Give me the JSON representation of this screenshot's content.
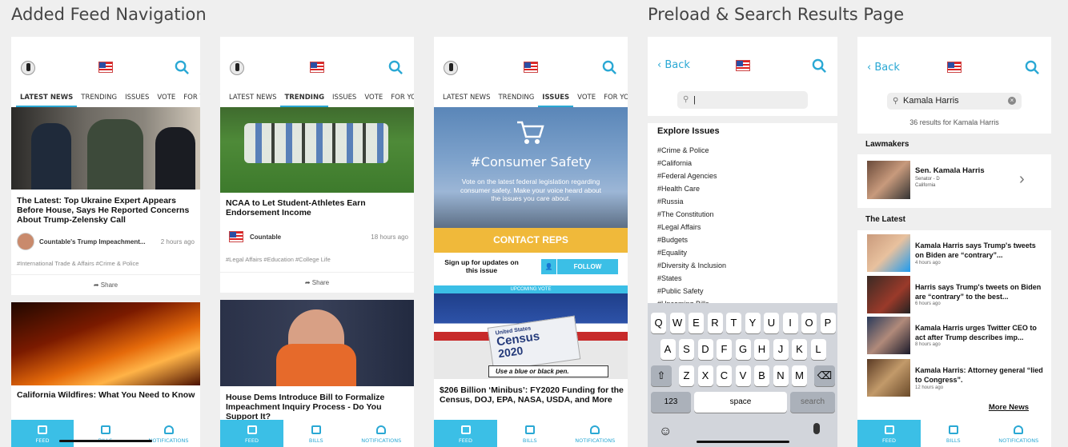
{
  "titles": {
    "left": "Added Feed Navigation",
    "right": "Preload & Search Results Page"
  },
  "colors": {
    "accent": "#2aa8d4",
    "contact": "#f0b93a"
  },
  "tabs": [
    "LATEST NEWS",
    "TRENDING",
    "ISSUES",
    "VOTE",
    "FOR YOU"
  ],
  "bottom_nav": {
    "feed": "FEED",
    "bills": "BILLS",
    "notifications": "NOTIFICATIONS"
  },
  "phone1": {
    "card1": {
      "title": "The Latest: Top Ukraine Expert Appears Before House, Says He Reported Concerns About Trump-Zelensky Call",
      "source": "Countable's Trump Impeachment...",
      "time": "2 hours ago",
      "tags": "#International Trade & Affairs  #Crime & Police",
      "share": "Share"
    },
    "card2": {
      "title": "California Wildfires: What You Need to Know"
    }
  },
  "phone2": {
    "card1": {
      "title": "NCAA to Let Student-Athletes Earn Endorsement Income",
      "source": "Countable",
      "time": "18 hours ago",
      "tags": "#Legal Affairs  #Education  #College Life",
      "share": "Share"
    },
    "card2": {
      "title": "House Dems Introduce Bill to Formalize Impeachment Inquiry Process - Do You Support It?"
    }
  },
  "phone3": {
    "issue_title": "#Consumer Safety",
    "issue_desc": "Vote on the latest federal legislation regarding consumer safety. Make your voice heard about the issues you care about.",
    "contact": "CONTACT REPS",
    "signup": "Sign up for updates on this issue",
    "follow": "FOLLOW",
    "upcoming": "UPCOMING VOTE",
    "census_line1": "United States",
    "census_line2": "Census",
    "census_line3": "2020",
    "census_note": "Use a blue or black pen.",
    "card_title": "$206 Billion ‘Minibus’: FY2020 Funding for the Census, DOJ, EPA, NASA, USDA, and More"
  },
  "phone4": {
    "back": "Back",
    "explore": "Explore Issues",
    "issues": [
      "#Crime & Police",
      "#California",
      "#Federal Agencies",
      "#Health Care",
      "#Russia",
      "#The Constitution",
      "#Legal Affairs",
      "#Budgets",
      "#Equality",
      "#Diversity & Inclusion",
      "#States",
      "#Public Safety",
      "#Upcoming Bills"
    ],
    "keys_row1": [
      "Q",
      "W",
      "E",
      "R",
      "T",
      "Y",
      "U",
      "I",
      "O",
      "P"
    ],
    "keys_row2": [
      "A",
      "S",
      "D",
      "F",
      "G",
      "H",
      "J",
      "K",
      "L"
    ],
    "keys_row3": [
      "Z",
      "X",
      "C",
      "V",
      "B",
      "N",
      "M"
    ],
    "key_123": "123",
    "key_space": "space",
    "key_search": "search"
  },
  "phone5": {
    "back": "Back",
    "query": "Kamala Harris",
    "results_count": "36 results for",
    "results_query": "Kamala Harris",
    "lawmakers": "Lawmakers",
    "lawmaker": {
      "name": "Sen. Kamala Harris",
      "role": "Senator - D",
      "state": "California"
    },
    "latest": "The Latest",
    "news": [
      {
        "title": "Kamala Harris says Trump's tweets on Biden are “contrary”...",
        "time": "4 hours ago"
      },
      {
        "title": "Harris says Trump's tweets on Biden are “contrary” to the best...",
        "time": "6 hours ago"
      },
      {
        "title": "Kamala Harris urges Twitter CEO to act after Trump describes imp...",
        "time": "8 hours ago"
      },
      {
        "title": "Kamala Harris: Attorney general “lied to Congress”.",
        "time": "12 hours ago"
      }
    ],
    "more": "More News"
  }
}
